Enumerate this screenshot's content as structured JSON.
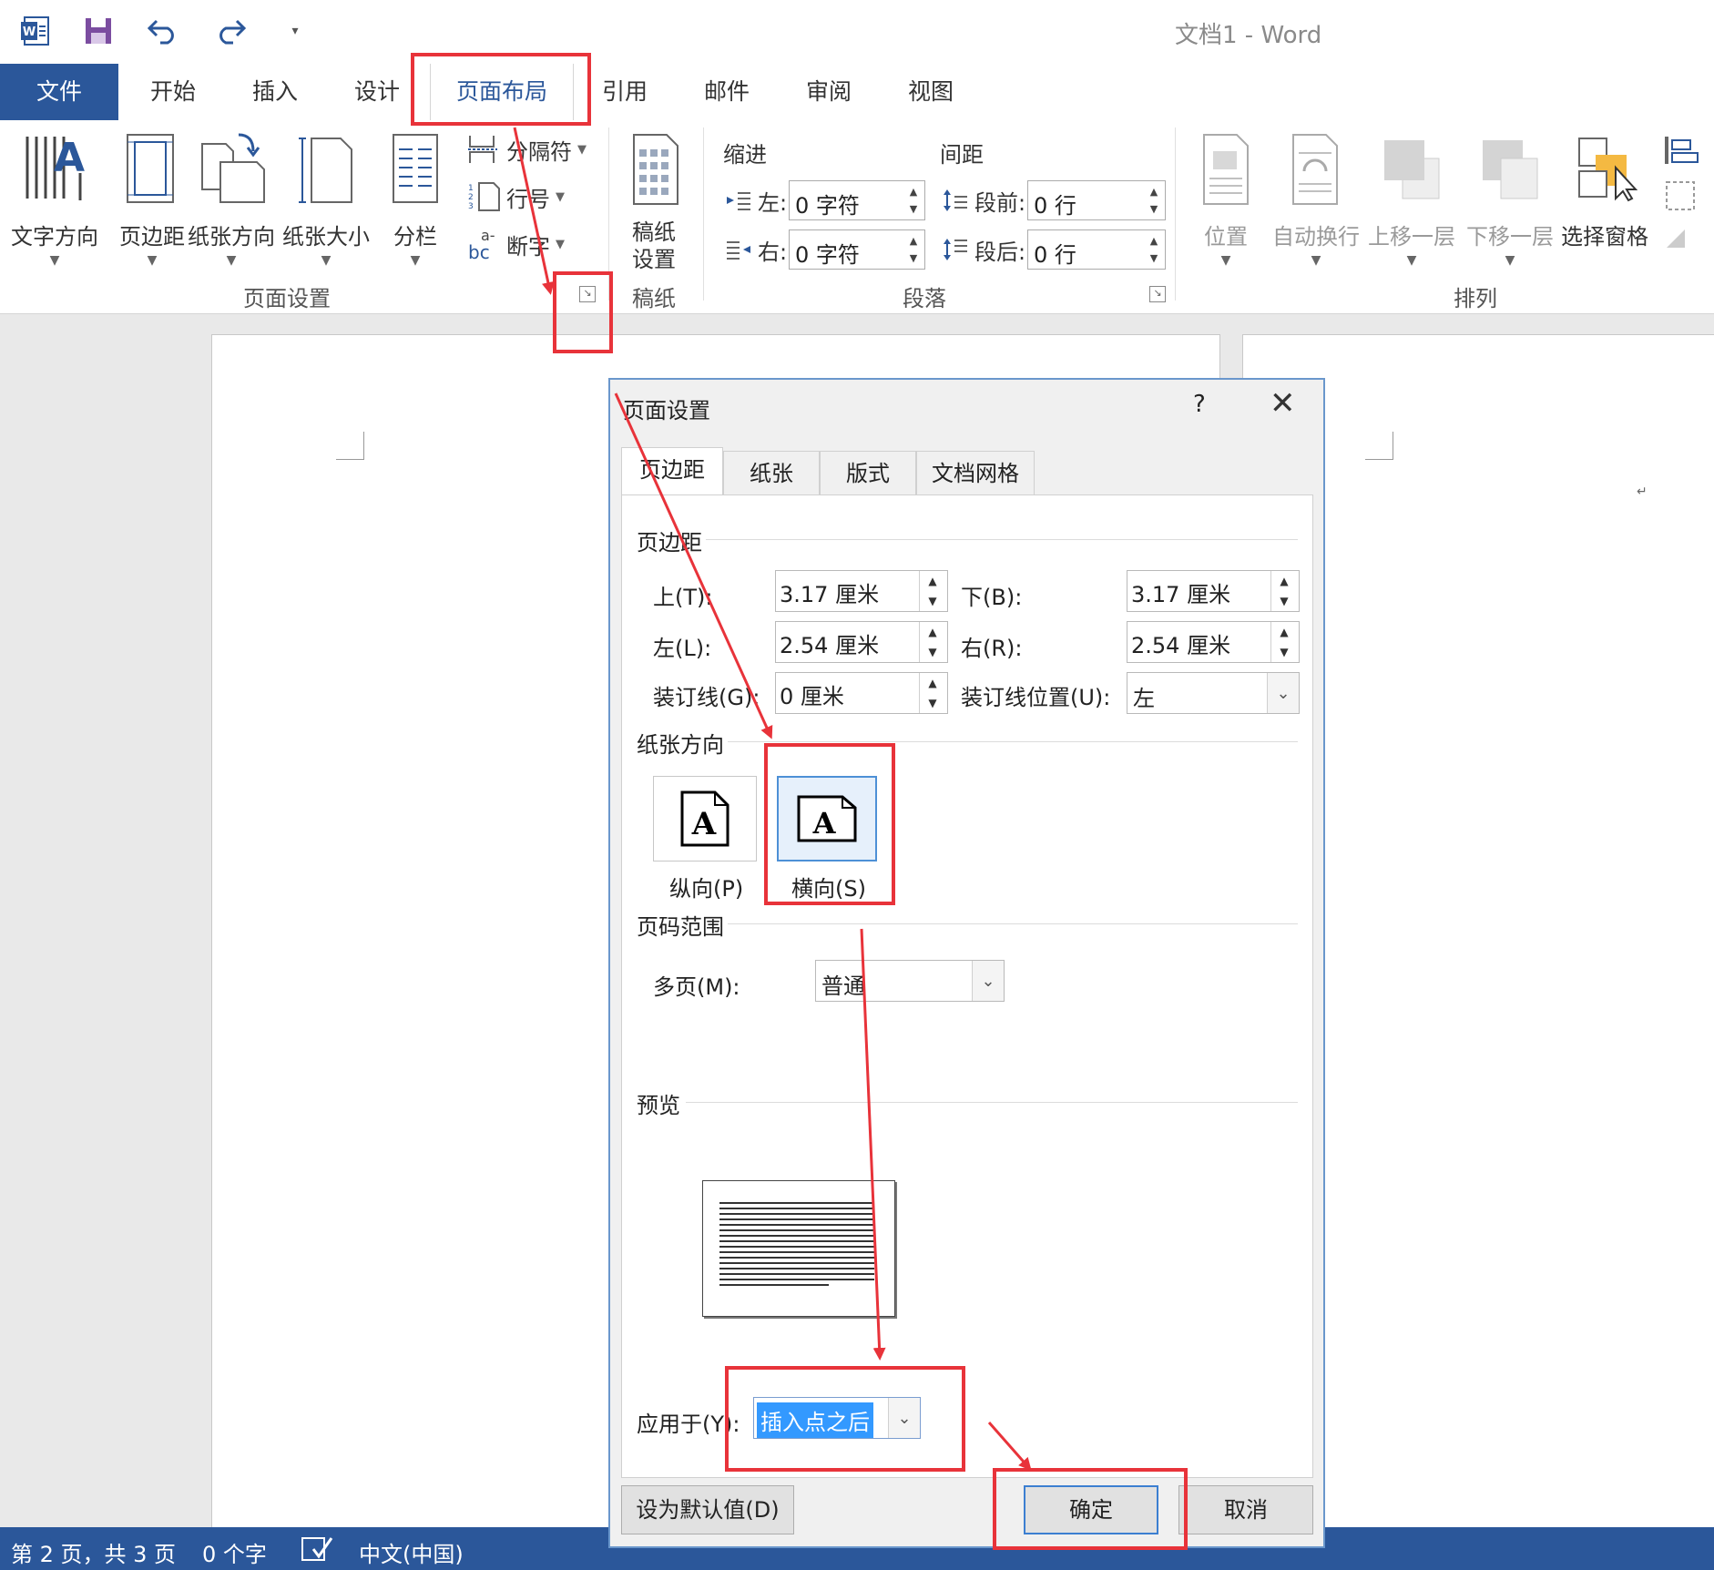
{
  "window": {
    "title": "文档1 - Word"
  },
  "tabs": [
    "文件",
    "开始",
    "插入",
    "设计",
    "页面布局",
    "引用",
    "邮件",
    "审阅",
    "视图"
  ],
  "ribbon": {
    "page_setup": {
      "text_direction": "文字方向",
      "margins": "页边距",
      "orientation": "纸张方向",
      "size": "纸张大小",
      "columns": "分栏",
      "breaks": "分隔符",
      "line_numbers": "行号",
      "hyphenation": "断字",
      "group_label": "页面设置"
    },
    "draft": {
      "label_line1": "稿纸",
      "label_line2": "设置",
      "group_label": "稿纸"
    },
    "paragraph": {
      "indent_head": "缩进",
      "spacing_head": "间距",
      "left_label": "左:",
      "left_value": "0 字符",
      "right_label": "右:",
      "right_value": "0 字符",
      "before_label": "段前:",
      "before_value": "0 行",
      "after_label": "段后:",
      "after_value": "0 行",
      "group_label": "段落"
    },
    "arrange": {
      "position": "位置",
      "wrap": "自动换行",
      "forward": "上移一层",
      "backward": "下移一层",
      "pane": "选择窗格",
      "group_label": "排列"
    }
  },
  "dialog": {
    "title": "页面设置",
    "help": "?",
    "tabs": [
      "页边距",
      "纸张",
      "版式",
      "文档网格"
    ],
    "margins_head": "页边距",
    "top_label": "上(T):",
    "top_value": "3.17 厘米",
    "bottom_label": "下(B):",
    "bottom_value": "3.17 厘米",
    "left_label": "左(L):",
    "left_value": "2.54 厘米",
    "right_label": "右(R):",
    "right_value": "2.54 厘米",
    "gutter_label": "装订线(G):",
    "gutter_value": "0 厘米",
    "gutter_pos_label": "装订线位置(U):",
    "gutter_pos_value": "左",
    "orientation_head": "纸张方向",
    "portrait": "纵向(P)",
    "landscape": "横向(S)",
    "pages_head": "页码范围",
    "multi_label": "多页(M):",
    "multi_value": "普通",
    "preview_head": "预览",
    "apply_label": "应用于(Y):",
    "apply_value": "插入点之后",
    "default_btn": "设为默认值(D)",
    "ok_btn": "确定",
    "cancel_btn": "取消"
  },
  "status": {
    "page": "第 2 页，共 3 页",
    "words": "0 个字",
    "lang": "中文(中国)"
  },
  "colors": {
    "accent": "#2b579a",
    "annotation": "#e8333a",
    "selection": "#3399ff"
  }
}
